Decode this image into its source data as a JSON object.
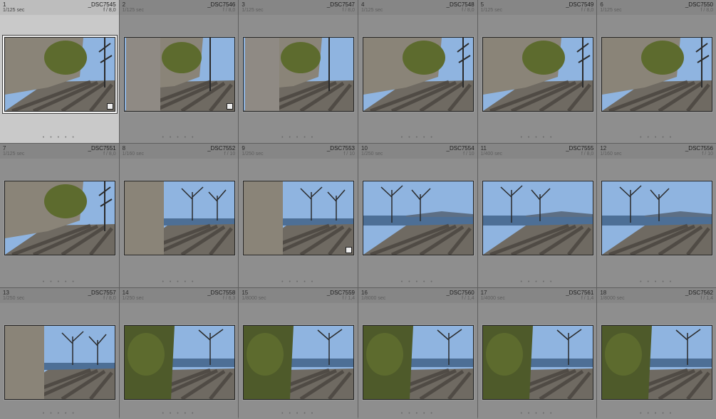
{
  "cells": [
    {
      "index": "1",
      "filename": "_DSC7545",
      "shutter": "1/125 sec",
      "aperture": "f / 8,0",
      "scene": "wall",
      "selected": true,
      "badge": true
    },
    {
      "index": "2",
      "filename": "_DSC7546",
      "shutter": "1/125 sec",
      "aperture": "f / 8,0",
      "scene": "trunk",
      "selected": false,
      "badge": true
    },
    {
      "index": "3",
      "filename": "_DSC7547",
      "shutter": "1/125 sec",
      "aperture": "f / 8,0",
      "scene": "trunk",
      "selected": false,
      "badge": false
    },
    {
      "index": "4",
      "filename": "_DSC7548",
      "shutter": "1/125 sec",
      "aperture": "f / 8,0",
      "scene": "wall",
      "selected": false,
      "badge": false
    },
    {
      "index": "5",
      "filename": "_DSC7549",
      "shutter": "1/125 sec",
      "aperture": "f / 8,0",
      "scene": "wall",
      "selected": false,
      "badge": false
    },
    {
      "index": "6",
      "filename": "_DSC7550",
      "shutter": "1/125 sec",
      "aperture": "f / 8,0",
      "scene": "wall",
      "selected": false,
      "badge": false
    },
    {
      "index": "7",
      "filename": "_DSC7551",
      "shutter": "1/125 sec",
      "aperture": "f / 8,0",
      "scene": "wall",
      "selected": false,
      "badge": false
    },
    {
      "index": "8",
      "filename": "_DSC7552",
      "shutter": "1/160 sec",
      "aperture": "f / 10",
      "scene": "promenade",
      "selected": false,
      "badge": false
    },
    {
      "index": "9",
      "filename": "_DSC7553",
      "shutter": "1/250 sec",
      "aperture": "f / 10",
      "scene": "promenade",
      "selected": false,
      "badge": true
    },
    {
      "index": "10",
      "filename": "_DSC7554",
      "shutter": "1/250 sec",
      "aperture": "f / 10",
      "scene": "lake",
      "selected": false,
      "badge": false
    },
    {
      "index": "11",
      "filename": "_DSC7555",
      "shutter": "1/400 sec",
      "aperture": "f / 8,0",
      "scene": "lake",
      "selected": false,
      "badge": false
    },
    {
      "index": "12",
      "filename": "_DSC7556",
      "shutter": "1/160 sec",
      "aperture": "f / 10",
      "scene": "lake",
      "selected": false,
      "badge": false
    },
    {
      "index": "13",
      "filename": "_DSC7557",
      "shutter": "1/250 sec",
      "aperture": "f / 8,0",
      "scene": "promenade",
      "selected": false,
      "badge": false
    },
    {
      "index": "14",
      "filename": "_DSC7558",
      "shutter": "1/250 sec",
      "aperture": "f / 6,3",
      "scene": "ivy",
      "selected": false,
      "badge": false
    },
    {
      "index": "15",
      "filename": "_DSC7559",
      "shutter": "1/8000 sec",
      "aperture": "f / 1,4",
      "scene": "ivy",
      "selected": false,
      "badge": false
    },
    {
      "index": "16",
      "filename": "_DSC7560",
      "shutter": "1/8000 sec",
      "aperture": "f / 1,4",
      "scene": "ivy",
      "selected": false,
      "badge": false
    },
    {
      "index": "17",
      "filename": "_DSC7561",
      "shutter": "1/4000 sec",
      "aperture": "f / 1,4",
      "scene": "ivy",
      "selected": false,
      "badge": false
    },
    {
      "index": "18",
      "filename": "_DSC7562",
      "shutter": "1/8000 sec",
      "aperture": "f / 1,4",
      "scene": "ivy",
      "selected": false,
      "badge": false
    }
  ],
  "colors": {
    "background": "#7d7d7d",
    "cell": "#8e8e8e",
    "selected_cell": "#c9c9c9",
    "sky": "#8fb4e0",
    "stone": "#8a8478",
    "cobble": "#6f6a62",
    "foliage": "#5d6b2e",
    "water": "#4d6f96"
  },
  "dots_label": "• • • • •"
}
